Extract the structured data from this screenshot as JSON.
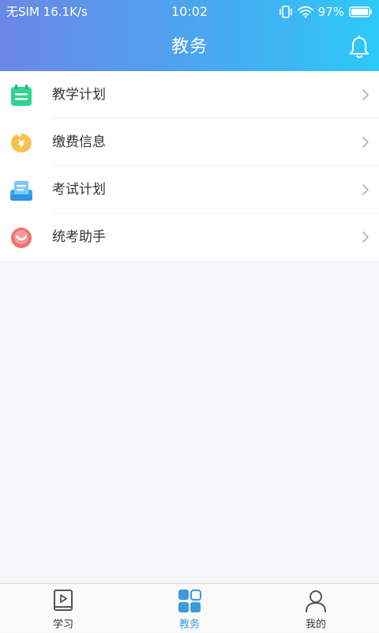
{
  "status_bar": {
    "carrier": "无SIM",
    "speed": "16.1K/s",
    "time": "10:02",
    "battery": "97%"
  },
  "header": {
    "title": "教务",
    "right_icon": "bell-icon"
  },
  "menu": {
    "items": [
      {
        "label": "教学计划",
        "icon": "calendar-icon",
        "color": "#2fd58f"
      },
      {
        "label": "缴费信息",
        "icon": "yen-coin-icon",
        "color": "#f6c34a"
      },
      {
        "label": "考试计划",
        "icon": "exam-paper-icon",
        "color": "#3aa8f5"
      },
      {
        "label": "统考助手",
        "icon": "smile-icon",
        "color": "#f37070"
      }
    ]
  },
  "tabbar": {
    "tabs": [
      {
        "label": "学习",
        "icon": "video-book-icon",
        "active": false
      },
      {
        "label": "教务",
        "icon": "grid-apps-icon",
        "active": true
      },
      {
        "label": "我的",
        "icon": "person-icon",
        "active": false
      }
    ]
  },
  "colors": {
    "header_gradient_start": "#6b87e5",
    "header_gradient_end": "#2ccaf8",
    "accent": "#3a9bdc",
    "background": "#f5f6fa"
  }
}
